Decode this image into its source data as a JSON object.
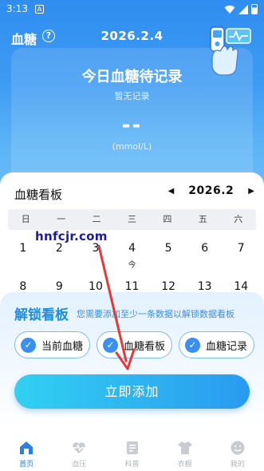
{
  "status_bar": {
    "time": "3:13",
    "notification": "A"
  },
  "header": {
    "title": "血糖",
    "help_icon": "?",
    "date": "2026.2.4"
  },
  "today": {
    "title": "今日血糖待记录",
    "subtitle": "暂无记录",
    "value": "--",
    "unit": "(mmol/L)"
  },
  "board": {
    "title": "血糖看板",
    "month": "2026.2",
    "prev_arrow": "◀",
    "next_arrow": "▶",
    "weekdays": [
      "日",
      "一",
      "二",
      "三",
      "四",
      "五",
      "六"
    ],
    "week1": [
      "1",
      "2",
      "3",
      "4",
      "5",
      "6",
      "7"
    ],
    "today_label": "今",
    "week2": [
      "8",
      "9",
      "10",
      "11",
      "12",
      "13",
      "14"
    ]
  },
  "watermark": "hnfcjr.com",
  "unlock": {
    "title": "解锁看板",
    "description": "您需要添加至少一条数据以解锁数据看板",
    "chips": [
      "当前血糖",
      "血糖看板",
      "血糖记录"
    ],
    "check": "✓",
    "cta": "立即添加"
  },
  "tabs": [
    "首页",
    "血压",
    "科普",
    "衣橱",
    "我的"
  ],
  "colors": {
    "primary": "#3b8ff0",
    "cta_start": "#32d0f2",
    "cta_end": "#2a9af0",
    "arrow": "#e53935",
    "tab_active": "#2a7fe0",
    "tab_inactive": "#b0b4b9"
  }
}
